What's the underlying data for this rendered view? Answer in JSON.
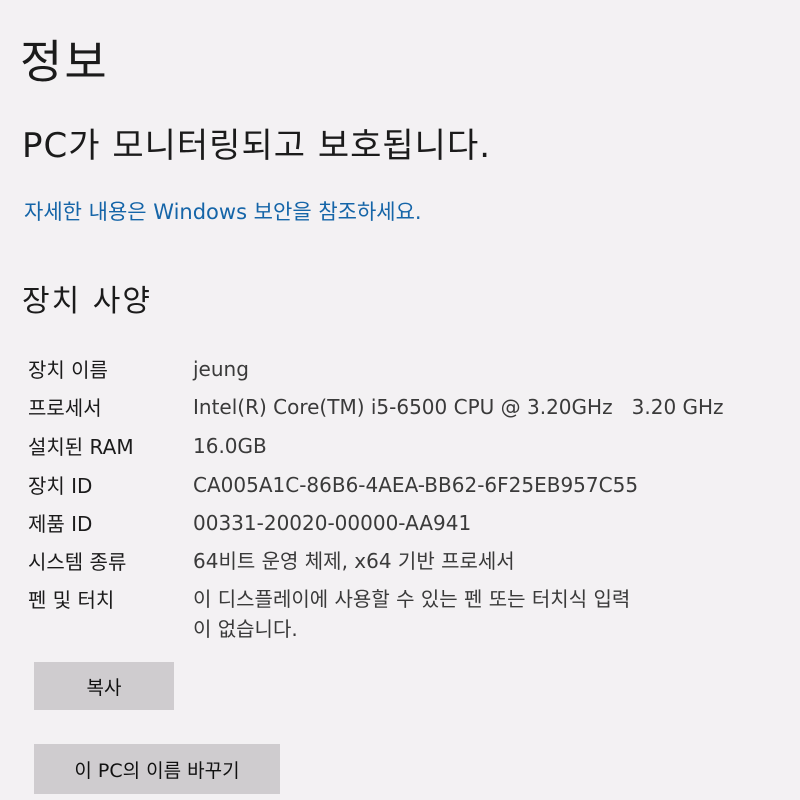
{
  "header": {
    "title": "정보",
    "status": "PC가 모니터링되고 보호됩니다.",
    "security_link": "자세한 내용은 Windows 보안을 참조하세요."
  },
  "device_specs": {
    "title": "장치 사양",
    "rows": [
      {
        "label": "장치 이름",
        "value": "jeung"
      },
      {
        "label": "프로세서",
        "value": "Intel(R) Core(TM) i5-6500 CPU @ 3.20GHz   3.20 GHz"
      },
      {
        "label": "설치된 RAM",
        "value": "16.0GB"
      },
      {
        "label": "장치 ID",
        "value": "CA005A1C-86B6-4AEA-BB62-6F25EB957C55"
      },
      {
        "label": "제품 ID",
        "value": "00331-20020-00000-AA941"
      },
      {
        "label": "시스템 종류",
        "value": "64비트 운영 체제, x64 기반 프로세서"
      },
      {
        "label": "펜 및 터치",
        "value": "이 디스플레이에 사용할 수 있는 펜 또는 터치식 입력\n이 없습니다."
      }
    ]
  },
  "buttons": {
    "copy": "복사",
    "rename": "이 PC의 이름 바꾸기"
  },
  "colors": {
    "link": "#1565a8",
    "button_bg": "#cfcccf",
    "background": "#f3f1f3"
  }
}
